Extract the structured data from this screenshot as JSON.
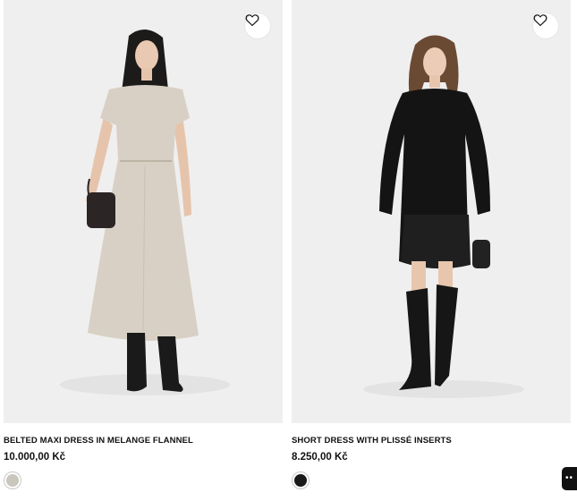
{
  "products": [
    {
      "title": "BELTED MAXI DRESS IN MELANGE FLANNEL",
      "price": "10.000,00 Kč",
      "swatch_color": "#c9c6bb",
      "dress_color": "#d8d0c4",
      "favorite_icon": "heart-outline-icon"
    },
    {
      "title": "SHORT DRESS WITH PLISSÉ INSERTS",
      "price": "8.250,00 Kč",
      "swatch_color": "#1a1a1a",
      "dress_color": "#141414",
      "favorite_icon": "heart-outline-icon"
    }
  ],
  "chat_widget": {
    "icon": "chat-dots-icon",
    "label": "••"
  },
  "colors": {
    "photo_bg": "#efefef",
    "text": "#111111"
  }
}
